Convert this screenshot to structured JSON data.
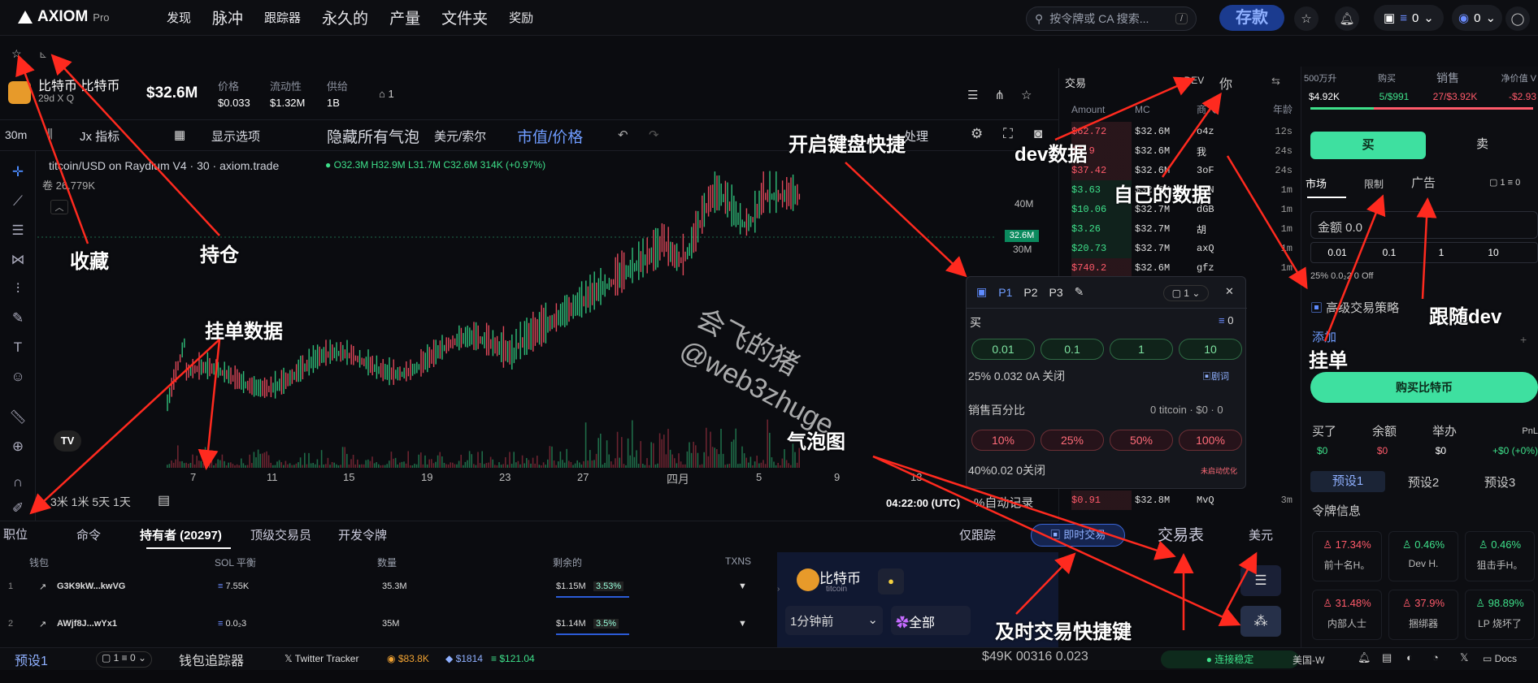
{
  "app": {
    "brand": "AXIOM",
    "brand_sub": "Pro"
  },
  "nav": [
    "发现",
    "脉冲",
    "跟踪器",
    "永久的",
    "产量",
    "文件夹",
    "奖励"
  ],
  "search": {
    "placeholder": "按令牌或 CA 搜索...",
    "kbd": "/"
  },
  "deposit_label": "存款",
  "wallet": {
    "count": "0",
    "sol": "0"
  },
  "token": {
    "name": "比特币 比特币",
    "sub": "29d X Q",
    "mcap": "$32.6M",
    "price_label": "价格",
    "price": "$0.033",
    "liq_label": "流动性",
    "liq": "$1.32M",
    "supply_label": "供给",
    "supply": "1B",
    "holders_icon_val": "1"
  },
  "toolbar": {
    "tf": "30m",
    "indicators": "Jx 指标",
    "display": "显示选项",
    "hide_bubbles": "隐藏所有气泡",
    "usd_sol": "美元/索尔",
    "mc_price": "市值/价格",
    "manage": "处理"
  },
  "chart_info": {
    "pair": "titcoin/USD on Raydium V4 · 30 · axiom.trade",
    "ohlc": "O32.3M H32.9M L31.7M C32.6M 314K (+0.97%)",
    "volume": "卷 26.779K",
    "price_tag": "32.6M",
    "y_ticks": [
      "40M",
      "30M"
    ],
    "x_ticks": [
      "7",
      "11",
      "15",
      "19",
      "23",
      "27",
      "四月",
      "5",
      "9",
      "13"
    ],
    "time": "04:22:00 (UTC)",
    "auto": "%自动记录",
    "ranges": "3米 1米 5天 1天"
  },
  "chart_data": {
    "type": "candlestick",
    "y_ticks": [
      "40M",
      "30M"
    ],
    "last_price": "32.6M",
    "x_ticks": [
      "7",
      "11",
      "15",
      "19",
      "23",
      "27",
      "四月",
      "5",
      "9",
      "13"
    ]
  },
  "bottom": {
    "tabs": [
      "职位",
      "命令",
      "持有者 (20297)",
      "顶级交易员",
      "开发令牌"
    ],
    "only_follow": "仅跟踪",
    "instant": "即时交易",
    "trades_table": "交易表",
    "usd": "美元",
    "columns": [
      "钱包",
      "SOL 平衡",
      "数量",
      "剩余的",
      "TXNS"
    ],
    "rows": [
      {
        "idx": "1",
        "wallet": "G3K9kW...kwVG",
        "sol": "7.55K",
        "qty": "35.3M",
        "remain": "$1.15M",
        "pct": "3.53%"
      },
      {
        "idx": "2",
        "wallet": "AWjf8J...wYx1",
        "sol": "0.0₂3",
        "qty": "35M",
        "remain": "$1.14M",
        "pct": "3.5%"
      }
    ]
  },
  "instant_panel": {
    "token": "比特币",
    "sub": "titcoin",
    "time": "1分钟前",
    "all": "全部"
  },
  "trades": {
    "title": "交易",
    "dev": "DEV",
    "you": "你",
    "headers": [
      "Amount",
      "MC",
      "商人",
      "年龄"
    ],
    "rows": [
      {
        "amt": "$62.72",
        "mc": "$32.6M",
        "trader": "o4z",
        "age": "12s",
        "c": "red"
      },
      {
        "amt": "$2.9",
        "mc": "$32.6M",
        "trader": "我",
        "age": "24s",
        "c": "red"
      },
      {
        "amt": "$37.42",
        "mc": "$32.6M",
        "trader": "3oF",
        "age": "24s",
        "c": "red"
      },
      {
        "amt": "$3.63",
        "mc": "$32.6M",
        "trader": "LVN",
        "age": "1m",
        "c": "green"
      },
      {
        "amt": "$10.06",
        "mc": "$32.7M",
        "trader": "dGB",
        "age": "1m",
        "c": "green"
      },
      {
        "amt": "$3.26",
        "mc": "$32.7M",
        "trader": "胡",
        "age": "1m",
        "c": "green"
      },
      {
        "amt": "$20.73",
        "mc": "$32.7M",
        "trader": "axQ",
        "age": "1m",
        "c": "green"
      },
      {
        "amt": "$740.2",
        "mc": "$32.6M",
        "trader": "gfz",
        "age": "1m",
        "c": "red"
      },
      {
        "amt": "$0.91",
        "mc": "$32.8M",
        "trader": "MvQ",
        "age": "3m",
        "c": "red"
      }
    ]
  },
  "float": {
    "tabs": [
      "P1",
      "P2",
      "P3"
    ],
    "count": "1",
    "buy": "买",
    "buy_amt": "0",
    "buy_opts": [
      "0.01",
      "0.1",
      "1",
      "10"
    ],
    "buy_settings": "25% 0.032 0A 关闭",
    "buy_tag": "剧词",
    "sell": "销售百分比",
    "sell_bal": "0 titcoin · $0 · 0",
    "sell_opts": [
      "10%",
      "25%",
      "50%",
      "100%"
    ],
    "sell_settings": "40%0.02 0关闭",
    "sell_tag": "未启动优化"
  },
  "right": {
    "stats_h": [
      "500万升",
      "购买",
      "销售",
      "净价值 V"
    ],
    "stats_v": [
      "$4.92K",
      "5/$991",
      "27/$3.92K",
      "-$2.93"
    ],
    "buy": "买",
    "sell": "卖",
    "tabs": [
      "市场",
      "限制",
      "广告"
    ],
    "amount": "金额 0.0",
    "qty": [
      "0.01",
      "0.1",
      "1",
      "10"
    ],
    "settings": "25%  0.0₂2  0  Off",
    "adv": "高级交易策略",
    "add": "添加",
    "buy_btn": "购买比特币",
    "bal_h": [
      "买了",
      "余额",
      "举办",
      "PnL"
    ],
    "bal_v": [
      "$0",
      "$0",
      "$0",
      "+$0 (+0%)"
    ],
    "presets": [
      "预设1",
      "预设2",
      "预设3"
    ],
    "token_info": "令牌信息",
    "info": [
      {
        "v": "17.34%",
        "l": "前十名H。",
        "c": "red"
      },
      {
        "v": "0.46%",
        "l": "Dev H.",
        "c": "green"
      },
      {
        "v": "0.46%",
        "l": "狙击手H。",
        "c": "green"
      },
      {
        "v": "31.48%",
        "l": "内部人士",
        "c": "red"
      },
      {
        "v": "37.9%",
        "l": "捆绑器",
        "c": "red"
      },
      {
        "v": "98.89%",
        "l": "LP 烧坏了",
        "c": "green"
      }
    ]
  },
  "status": {
    "preset": "预设1",
    "wallet_tracker": "钱包追踪器",
    "twitter": "Twitter Tracker",
    "btc": "$83.8K",
    "eth": "$1814",
    "sol": "$121.04",
    "mc": "$49K 00316 0.023",
    "conn": "连接稳定",
    "region": "美国-W",
    "docs": "Docs"
  },
  "watermark": {
    "l1": "会飞的猪",
    "l2": "@web3zhuge"
  },
  "annotations": [
    "收藏",
    "持仓",
    "挂单数据",
    "开启键盘快捷",
    "dev数据",
    "自己的数据",
    "气泡图",
    "及时交易快捷键",
    "挂单",
    "跟随dev"
  ]
}
